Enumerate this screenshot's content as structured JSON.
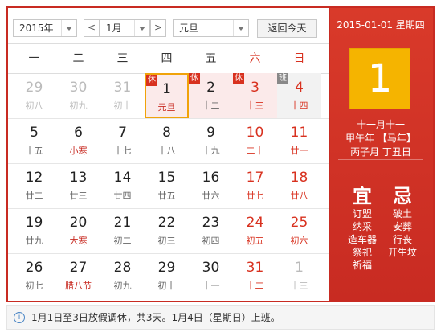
{
  "controls": {
    "year": "2015年",
    "prev": "<",
    "month": "1月",
    "next": ">",
    "holiday": "元旦",
    "today_button": "返回今天"
  },
  "weekdays": [
    "一",
    "二",
    "三",
    "四",
    "五",
    "六",
    "日"
  ],
  "tags": {
    "rest": "休",
    "work": "班"
  },
  "weeks": [
    [
      {
        "day": "29",
        "lunar": "初八",
        "other": true
      },
      {
        "day": "30",
        "lunar": "初九",
        "other": true
      },
      {
        "day": "31",
        "lunar": "初十",
        "other": true
      },
      {
        "day": "1",
        "lunar": "元旦",
        "tag": "rest",
        "selected": true,
        "fest": true
      },
      {
        "day": "2",
        "lunar": "十二",
        "tag": "rest",
        "holiday": true
      },
      {
        "day": "3",
        "lunar": "十三",
        "tag": "rest",
        "holiday": true
      },
      {
        "day": "4",
        "lunar": "十四",
        "tag": "work",
        "workday": true
      }
    ],
    [
      {
        "day": "5",
        "lunar": "十五"
      },
      {
        "day": "6",
        "lunar": "小寒",
        "fest": true
      },
      {
        "day": "7",
        "lunar": "十七"
      },
      {
        "day": "8",
        "lunar": "十八"
      },
      {
        "day": "9",
        "lunar": "十九"
      },
      {
        "day": "10",
        "lunar": "二十"
      },
      {
        "day": "11",
        "lunar": "廿一"
      }
    ],
    [
      {
        "day": "12",
        "lunar": "廿二"
      },
      {
        "day": "13",
        "lunar": "廿三"
      },
      {
        "day": "14",
        "lunar": "廿四"
      },
      {
        "day": "15",
        "lunar": "廿五"
      },
      {
        "day": "16",
        "lunar": "廿六"
      },
      {
        "day": "17",
        "lunar": "廿七"
      },
      {
        "day": "18",
        "lunar": "廿八"
      }
    ],
    [
      {
        "day": "19",
        "lunar": "廿九"
      },
      {
        "day": "20",
        "lunar": "大寒",
        "fest": true
      },
      {
        "day": "21",
        "lunar": "初二"
      },
      {
        "day": "22",
        "lunar": "初三"
      },
      {
        "day": "23",
        "lunar": "初四"
      },
      {
        "day": "24",
        "lunar": "初五"
      },
      {
        "day": "25",
        "lunar": "初六"
      }
    ],
    [
      {
        "day": "26",
        "lunar": "初七"
      },
      {
        "day": "27",
        "lunar": "腊八节",
        "fest": true
      },
      {
        "day": "28",
        "lunar": "初九"
      },
      {
        "day": "29",
        "lunar": "初十"
      },
      {
        "day": "30",
        "lunar": "十一"
      },
      {
        "day": "31",
        "lunar": "十二"
      },
      {
        "day": "1",
        "lunar": "十三",
        "other": true
      }
    ]
  ],
  "side": {
    "date": "2015-01-01 星期四",
    "big_day": "1",
    "lunar_date": "十一月十一",
    "ganzhi_year": "甲午年 【马年】",
    "ganzhi_month_day": "丙子月 丁丑日",
    "yi_label": "宜",
    "ji_label": "忌",
    "yi_items": [
      "订盟",
      "纳采",
      "造车器",
      "祭祀",
      "祈福"
    ],
    "ji_items": [
      "破土",
      "安葬",
      "行丧",
      "开生坟"
    ]
  },
  "footer": {
    "info_icon": "i",
    "text": "1月1日至3日放假调休，共3天。1月4日（星期日）上班。"
  },
  "colors": {
    "accent": "#c82b22",
    "selected_border": "#f0a30a",
    "big_day_bg": "#f5b400"
  }
}
